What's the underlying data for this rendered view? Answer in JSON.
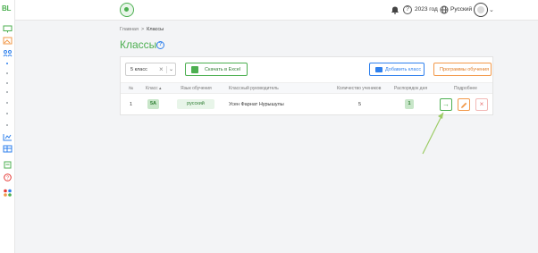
{
  "app": {
    "logo_text": "BL",
    "logo_chevron": "›"
  },
  "topbar": {
    "bell_icon": "bell-icon",
    "help_symbol": "?",
    "year": "2023 год",
    "language": "Русский",
    "avatar_icon": "avatar-icon",
    "dropdown_symbol": "⌄"
  },
  "breadcrumb": {
    "home": "Главная",
    "separator": ">",
    "current": "Классы"
  },
  "page": {
    "title": "Классы",
    "help_symbol": "?"
  },
  "toolbar": {
    "class_select": {
      "value": "5 класс",
      "clear_symbol": "×",
      "arrow_symbol": "⌄"
    },
    "excel_label": "Скачать в Excel",
    "add_label": "Добавить класс",
    "programs_label": "Программы обучения"
  },
  "table": {
    "headers": [
      "№",
      "Класс ▴",
      "Язык обучения",
      "Классный руководитель",
      "Количество учеников",
      "Распорядок дня",
      "Подробнее"
    ],
    "rows": [
      {
        "num": "1",
        "class": "5А",
        "language": "русский",
        "teacher": "Усен Фарнат Нурышулы",
        "students": "5",
        "schedule": "1"
      }
    ],
    "action_go_symbol": "→",
    "action_delete_symbol": "×"
  },
  "colors": {
    "accent_green": "#4caf50",
    "accent_blue": "#2f80ed",
    "accent_orange": "#f2994a"
  }
}
